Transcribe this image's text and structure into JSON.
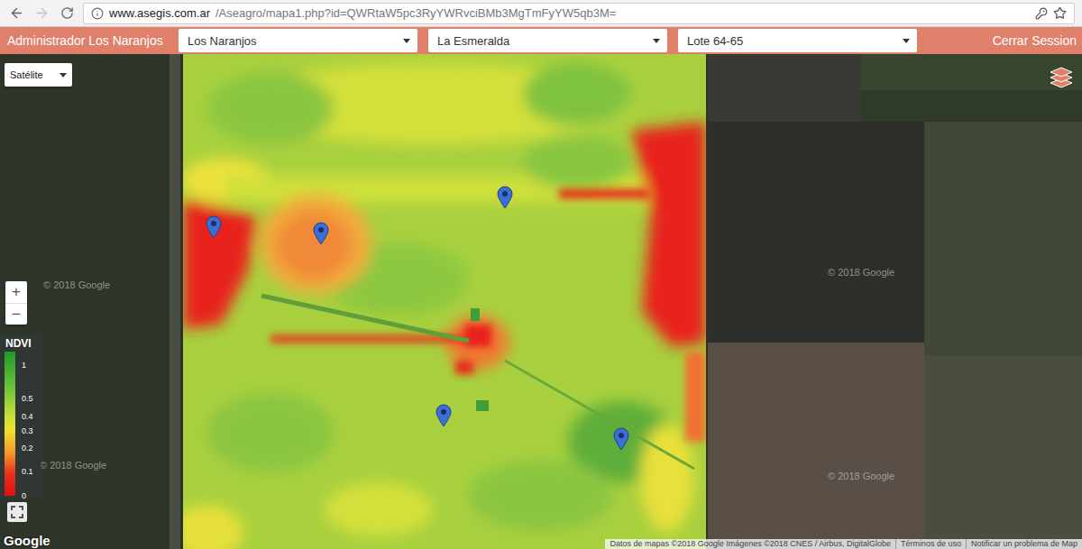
{
  "browser": {
    "url_host": "www.asegis.com.ar",
    "url_path": "/Aseagro/mapa1.php?id=QWRtaW5pc3RyYWRvciBMb3MgTmFyYW5qb3M=",
    "forward_disabled": true,
    "bookmarked": false
  },
  "header": {
    "title": "Administrador Los Naranjos",
    "selects": [
      {
        "value": "Los Naranjos"
      },
      {
        "value": "La Esmeralda"
      },
      {
        "value": "Lote 64-65"
      }
    ],
    "logout": "Cerrar Session"
  },
  "map": {
    "type_select": "Satélite",
    "zoom_in": "+",
    "zoom_out": "−",
    "legend": {
      "title": "NDVI",
      "ticks": [
        "1",
        "0.5",
        "0.4",
        "0.3",
        "0.2",
        "0.1",
        "0"
      ]
    },
    "watermarks": [
      "© 2018 Google",
      "© 2018 Google",
      "© 2018 Google",
      "© 2018 Google"
    ],
    "logo": "Google",
    "attribution": [
      "Datos de mapas ©2018 Google Imágenes ©2018 CNES / Airbus, DigitalGlobe",
      "Términos de uso",
      "Notificar un problema de Map"
    ]
  }
}
